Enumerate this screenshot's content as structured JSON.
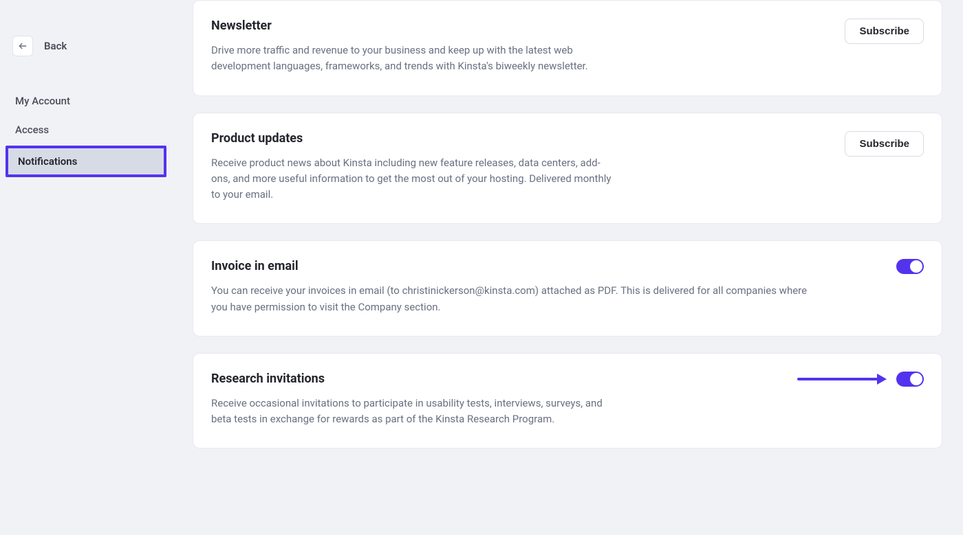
{
  "sidebar": {
    "back_label": "Back",
    "nav": {
      "my_account": "My Account",
      "access": "Access",
      "notifications": "Notifications"
    }
  },
  "cards": {
    "newsletter": {
      "title": "Newsletter",
      "desc": "Drive more traffic and revenue to your business and keep up with the latest web development languages, frameworks, and trends with Kinsta's biweekly newsletter.",
      "action_label": "Subscribe"
    },
    "product_updates": {
      "title": "Product updates",
      "desc": "Receive product news about Kinsta including new feature releases, data centers, add-ons, and more useful information to get the most out of your hosting. Delivered monthly to your email.",
      "action_label": "Subscribe"
    },
    "invoice": {
      "title": "Invoice in email",
      "desc": "You can receive your invoices in email (to christinickerson@kinsta.com) attached as PDF. This is delivered for all companies where you have permission to visit the Company section."
    },
    "research": {
      "title": "Research invitations",
      "desc": "Receive occasional invitations to participate in usability tests, interviews, surveys, and beta tests in exchange for rewards as part of the Kinsta Research Program."
    }
  }
}
